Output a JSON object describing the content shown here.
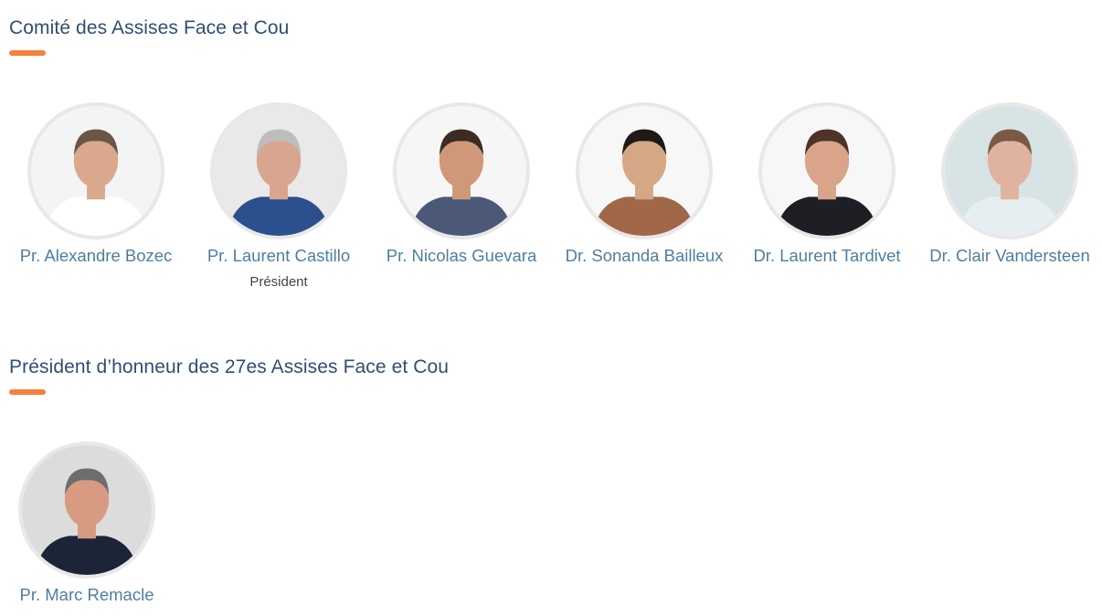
{
  "committee": {
    "title": "Comité des Assises Face et Cou",
    "members": [
      {
        "name": "Pr. Alexandre Bozec",
        "role": "",
        "photo": "portrait-photo",
        "colors": {
          "bg": "#f3f4f6",
          "skin": "#d9a88d",
          "hair": "#6b5645",
          "clothes": "#ffffff"
        }
      },
      {
        "name": "Pr. Laurent Castillo",
        "role": "Président",
        "photo": "portrait-photo",
        "colors": {
          "bg": "#e9e9e9",
          "skin": "#d8a590",
          "hair": "#bdbdbd",
          "clothes": "#2c4f8e"
        }
      },
      {
        "name": "Pr. Nicolas Guevara",
        "role": "",
        "photo": "portrait-photo",
        "colors": {
          "bg": "#f6f6f6",
          "skin": "#cf9878",
          "hair": "#3a2c22",
          "clothes": "#4b5877"
        }
      },
      {
        "name": "Dr. Sonanda Bailleux",
        "role": "",
        "photo": "portrait-photo",
        "colors": {
          "bg": "#f7f7f7",
          "skin": "#d6a784",
          "hair": "#1f1a18",
          "clothes": "#a06848"
        }
      },
      {
        "name": "Dr. Laurent Tardivet",
        "role": "",
        "photo": "portrait-photo",
        "colors": {
          "bg": "#f7f7f7",
          "skin": "#d9a48a",
          "hair": "#4e3426",
          "clothes": "#1e1f24"
        }
      },
      {
        "name": "Dr. Clair Vandersteen",
        "role": "",
        "photo": "portrait-photo",
        "colors": {
          "bg": "#d7e3e4",
          "skin": "#e0b2a0",
          "hair": "#7b5a45",
          "clothes": "#e7eef2"
        }
      }
    ]
  },
  "honorary": {
    "title": "Président d’honneur des 27es Assises Face et Cou",
    "members": [
      {
        "name": "Pr. Marc Remacle",
        "role": "",
        "photo": "portrait-photo",
        "colors": {
          "bg": "#dcdcdc",
          "skin": "#d79b82",
          "hair": "#6d6d6d",
          "clothes": "#1c2438"
        }
      }
    ]
  },
  "accent_color": "#f5813a",
  "title_color": "#2e4e74",
  "name_color": "#4e7ea3"
}
